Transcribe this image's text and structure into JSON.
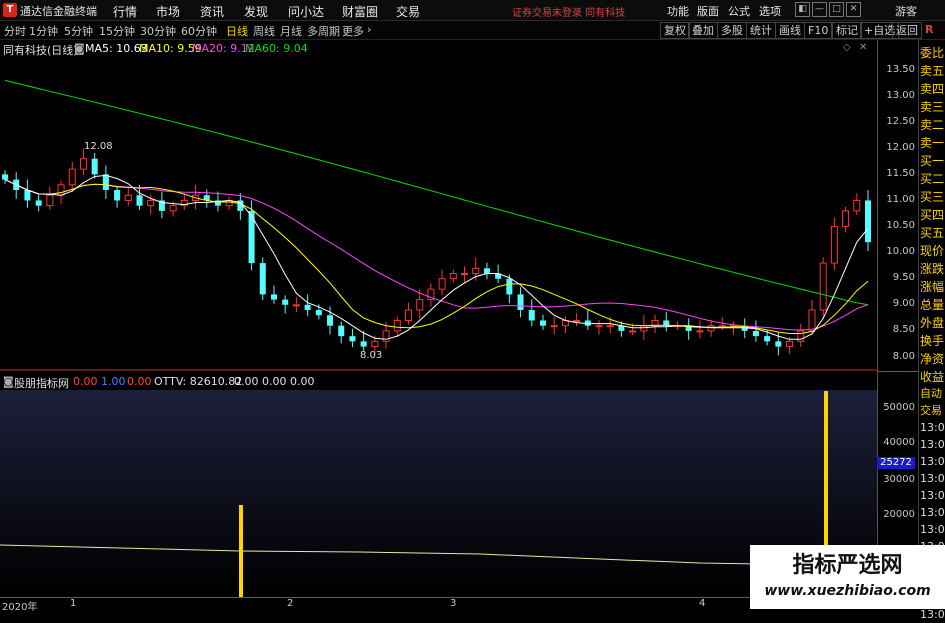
{
  "titlebar": {
    "logo": "T",
    "app_title": "通达信金融终端",
    "menus": [
      "行情",
      "市场",
      "资讯",
      "发现",
      "问小达",
      "财富圈",
      "交易"
    ],
    "notice": "证券交易未登录  同有科技",
    "right_menus": [
      "功能",
      "版面",
      "公式",
      "选项"
    ],
    "guest": "游客"
  },
  "toolbar": {
    "periods": [
      "分时",
      "1分钟",
      "5分钟",
      "15分钟",
      "30分钟",
      "60分钟",
      "日线",
      "周线",
      "月线",
      "多周期",
      "更多"
    ],
    "active_period": "日线",
    "buttons": [
      "复权",
      "叠加",
      "多股",
      "统计",
      "画线",
      "F10",
      "标记",
      "+自选",
      "返回"
    ],
    "r_mark": "R"
  },
  "main_legend": {
    "stock": "同有科技(日线)",
    "ma5": "MA5: 10.63",
    "ma10": "MA10: 9.59",
    "ma20": "MA20: 9.12",
    "ma60": "MA60: 9.04",
    "high_label": "12.08",
    "low_label": "8.03"
  },
  "colors": {
    "up": "#ff3232",
    "down": "#54fcfc",
    "ma5": "#ffffff",
    "ma10": "#ffff00",
    "ma20": "#ff44ff",
    "ma60": "#00e000",
    "volume": "#ffd200",
    "line": "#e8e8a0"
  },
  "price_axis": [
    "13.50",
    "13.00",
    "12.50",
    "12.00",
    "11.50",
    "11.00",
    "10.50",
    "10.00",
    "9.50",
    "9.00",
    "8.50",
    "8.00"
  ],
  "sub_legend": {
    "name": "股朋指标网",
    "v1": "0.00",
    "v2": "1.00",
    "v3": "0.00",
    "ottv": "OTTV: 82610.82",
    "v4": "0.00",
    "v5": "0.00",
    "v6": "0.00"
  },
  "sub_axis": [
    "50000",
    "40000",
    "30000",
    "20000"
  ],
  "current_value": "25272",
  "side_labels": [
    "委比",
    "卖五",
    "卖四",
    "卖三",
    "卖二",
    "卖一",
    "买一",
    "买二",
    "买三",
    "买四",
    "买五",
    "现价",
    "涨跌",
    "涨幅",
    "总量",
    "外盘",
    "换手",
    "净资",
    "收益"
  ],
  "side_lower": [
    "自动",
    "交易",
    "13:02",
    "13:02",
    "13:02",
    "13:02",
    "13:02",
    "13:02",
    "13:02",
    "13:02",
    "13:02",
    "13:02",
    "13:02",
    "13:02"
  ],
  "dates": [
    "2020年",
    "1",
    "2",
    "3",
    "4"
  ],
  "watermark": {
    "title": "指标严选网",
    "url": "www.xuezhibiao.com"
  }
}
